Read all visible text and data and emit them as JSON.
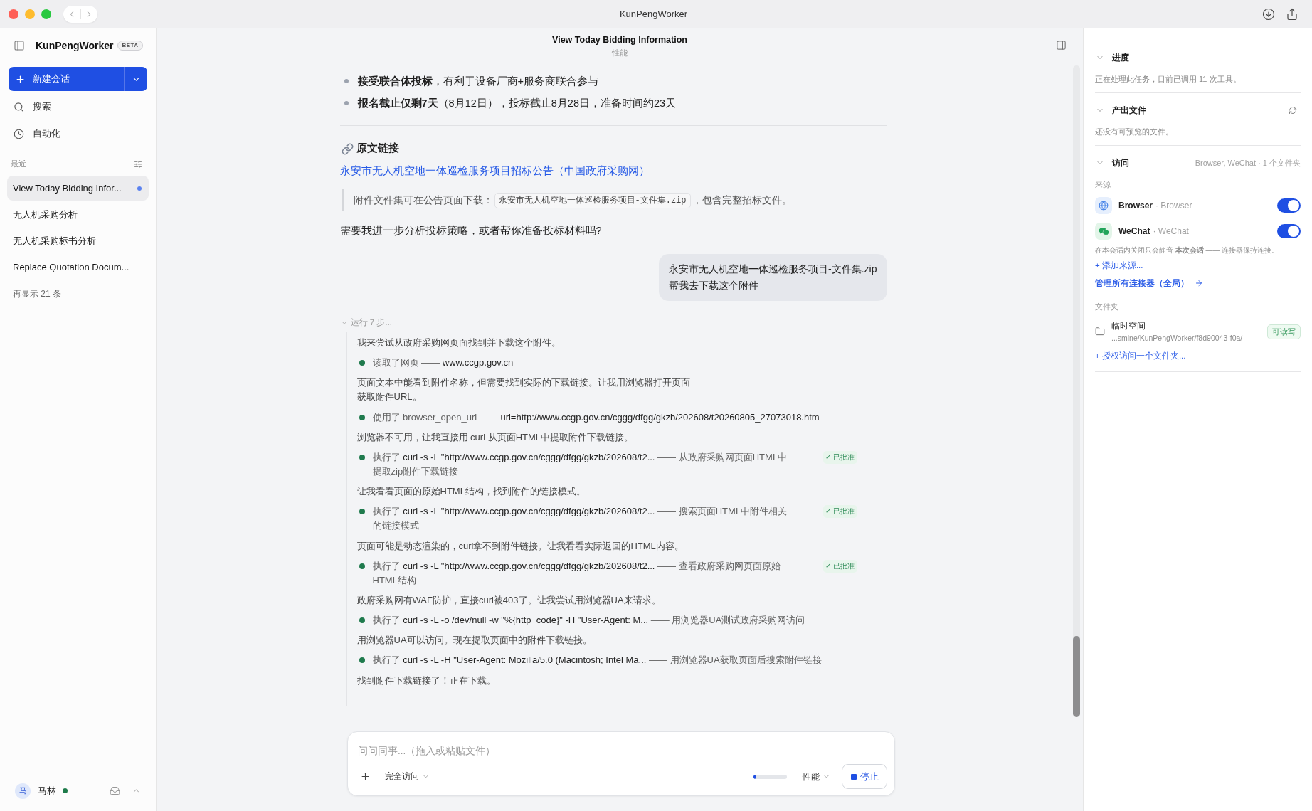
{
  "window": {
    "title": "KunPengWorker"
  },
  "sidebar": {
    "app_name": "KunPengWorker",
    "badge": "BETA",
    "new_chat": "新建会话",
    "nav": [
      {
        "kind": "search",
        "label": "搜索"
      },
      {
        "kind": "automation",
        "label": "自动化"
      }
    ],
    "recent_label": "最近",
    "conversations": [
      {
        "title": "View Today Bidding Infor...",
        "selected": true,
        "running": true
      },
      {
        "title": "无人机采购分析",
        "selected": false,
        "running": false
      },
      {
        "title": "无人机采购标书分析",
        "selected": false,
        "running": false
      },
      {
        "title": "Replace Quotation Docum...",
        "selected": false,
        "running": false
      }
    ],
    "show_more": "再显示 21 条",
    "user": {
      "avatar": "马",
      "name": "马林",
      "online": true
    }
  },
  "conversation": {
    "title": "View Today Bidding Information",
    "subtitle": "性能",
    "bullets": [
      "**接受联合体投标**，有利于设备厂商+服务商联合参与",
      "**报名截止仅剩7天**（8月12日），投标截止8月28日，准备时间约23天"
    ],
    "source_heading": "原文链接",
    "source_link": "永安市无人机空地一体巡检服务项目招标公告（中国政府采购网）",
    "quote": {
      "before": "附件文件集可在公告页面下载：",
      "code": "永安市无人机空地一体巡检服务项目-文件集.zip",
      "after": "，包含完整招标文件。"
    },
    "question": "需要我进一步分析投标策略，或者帮你准备投标材料吗?",
    "user_message": "永安市无人机空地一体巡检服务项目-文件集.zip\n帮我去下载这个附件",
    "steps": {
      "label": "运行 7 步...",
      "expanded": true,
      "items": [
        {
          "kind": "note",
          "text": "我来尝试从政府采购网页面找到并下载这个附件。"
        },
        {
          "kind": "tool",
          "done": true,
          "segments": [
            {
              "kind": "action",
              "text": "读取了网页 ——"
            },
            {
              "kind": "target",
              "text": "www.ccgp.gov.cn"
            }
          ]
        },
        {
          "kind": "note",
          "text": "页面文本中能看到附件名称，但需要找到实际的下载链接。让我用浏览器打开页面获取附件URL。"
        },
        {
          "kind": "tool",
          "done": true,
          "segments": [
            {
              "kind": "action",
              "text": "使用了 browser_open_url ——"
            },
            {
              "kind": "target",
              "text": "url=http://www.ccgp.gov.cn/cggg/dfgg/gkzb/202608/t20260805_27073018.htm"
            }
          ]
        },
        {
          "kind": "note",
          "text": "浏览器不可用，让我直接用 curl 从页面HTML中提取附件下载链接。"
        },
        {
          "kind": "tool",
          "done": true,
          "approval": {
            "label": "✓ 已批准",
            "approved": true
          },
          "segments": [
            {
              "kind": "action",
              "text": "执行了"
            },
            {
              "kind": "target",
              "text": "curl -s -L \"http://www.ccgp.gov.cn/cggg/dfgg/gkzb/202608/t2..."
            },
            {
              "kind": "description",
              "text": "—— 从政府采购网页面HTML中提取zip附件下载链接"
            }
          ]
        },
        {
          "kind": "note",
          "text": "让我看看页面的原始HTML结构，找到附件的链接模式。"
        },
        {
          "kind": "tool",
          "done": true,
          "approval": {
            "label": "✓ 已批准",
            "approved": true
          },
          "segments": [
            {
              "kind": "action",
              "text": "执行了"
            },
            {
              "kind": "target",
              "text": "curl -s -L \"http://www.ccgp.gov.cn/cggg/dfgg/gkzb/202608/t2..."
            },
            {
              "kind": "description",
              "text": "—— 搜索页面HTML中附件相关的链接模式"
            }
          ]
        },
        {
          "kind": "note",
          "text": "页面可能是动态渲染的，curl拿不到附件链接。让我看看实际返回的HTML内容。"
        },
        {
          "kind": "tool",
          "done": true,
          "approval": {
            "label": "✓ 已批准",
            "approved": true
          },
          "segments": [
            {
              "kind": "action",
              "text": "执行了"
            },
            {
              "kind": "target",
              "text": "curl -s -L \"http://www.ccgp.gov.cn/cggg/dfgg/gkzb/202608/t2..."
            },
            {
              "kind": "description",
              "text": "—— 查看政府采购网页面原始HTML结构"
            }
          ]
        },
        {
          "kind": "note",
          "text": "政府采购网有WAF防护，直接curl被403了。让我尝试用浏览器UA来请求。"
        },
        {
          "kind": "tool",
          "done": true,
          "segments": [
            {
              "kind": "action",
              "text": "执行了"
            },
            {
              "kind": "target",
              "text": "curl -s -L -o /dev/null -w \"%{http_code}\" -H \"User-Agent: M..."
            },
            {
              "kind": "description",
              "text": "—— 用浏览器UA测试政府采购网访问"
            }
          ]
        },
        {
          "kind": "note",
          "text": "用浏览器UA可以访问。现在提取页面中的附件下载链接。"
        },
        {
          "kind": "tool",
          "done": true,
          "segments": [
            {
              "kind": "action",
              "text": "执行了"
            },
            {
              "kind": "target",
              "text": "curl -s -L -H \"User-Agent: Mozilla/5.0 (Macintosh; Intel Ma..."
            },
            {
              "kind": "description",
              "text": "—— 用浏览器UA获取页面后搜索附件链接"
            }
          ]
        },
        {
          "kind": "note",
          "text": "找到附件下载链接了！正在下载。"
        }
      ]
    }
  },
  "panel": {
    "sections": [
      {
        "kind": "progress",
        "title": "进度",
        "expanded": true,
        "text": "正在处理此任务，目前已调用 11 次工具。"
      },
      {
        "kind": "outputs",
        "title": "产出文件",
        "expanded": true,
        "text": "还没有可预览的文件。"
      },
      {
        "kind": "access",
        "title": "访问",
        "expanded": true,
        "summary": "Browser, WeChat · 1 个文件夹",
        "sources_label": "来源",
        "sources": [
          {
            "kind": "browser",
            "name": "Browser",
            "detail": "· Browser",
            "on": true
          },
          {
            "kind": "wechat",
            "name": "WeChat",
            "detail": "· WeChat",
            "on": true
          }
        ],
        "note": "在本会话内关闭只会静音 **本次会话** —— 连接器保持连接。",
        "add_source": "+ 添加来源...",
        "manage_link": "管理所有连接器（全局）",
        "folders_label": "文件夹",
        "folders": [
          {
            "name": "临时空间",
            "path": "...smine/KunPengWorker/f8d90043-f0a/",
            "permission": "可读写"
          }
        ],
        "grant_folder": "+ 授权访问一个文件夹..."
      }
    ]
  },
  "composer": {
    "placeholder": "问问同事...（拖入或粘贴文件）",
    "access_mode": "完全访问",
    "usage": {
      "level": 0.06
    },
    "mode": "性能",
    "stop": "停止"
  }
}
